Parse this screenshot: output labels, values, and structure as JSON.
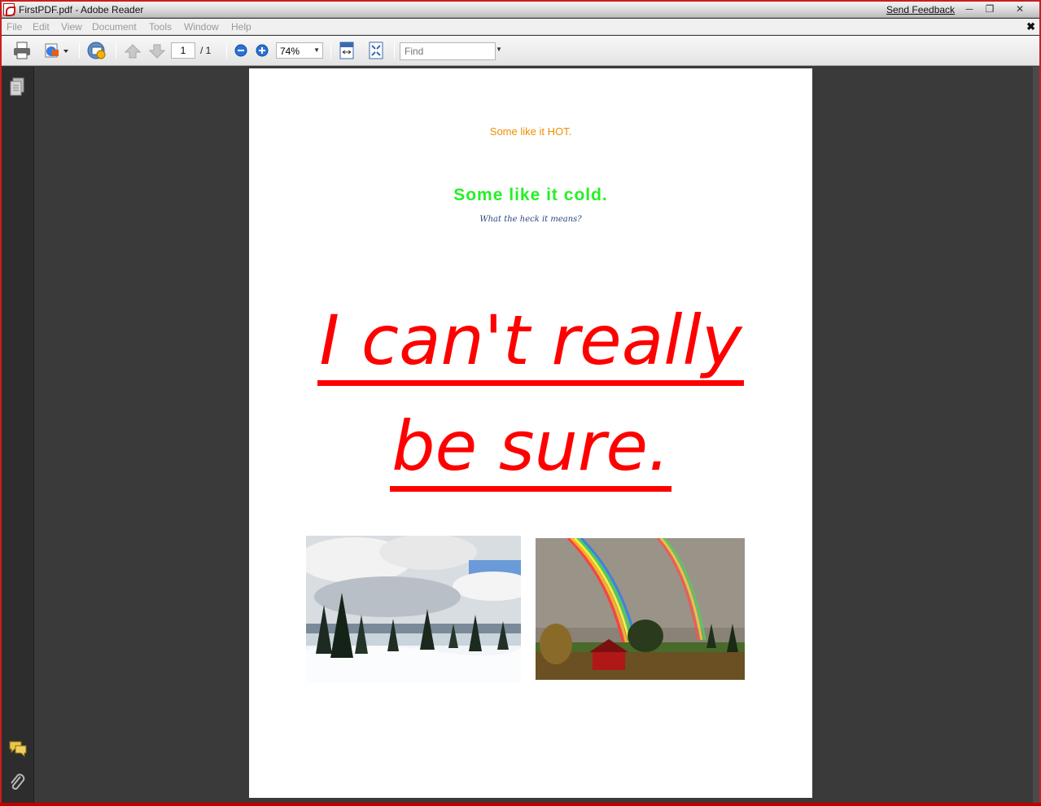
{
  "window": {
    "title": "FirstPDF.pdf - Adobe Reader",
    "send_feedback": "Send Feedback",
    "minimize": "─",
    "restore": "❐",
    "close": "✕"
  },
  "menu": {
    "items": [
      "File",
      "Edit",
      "View",
      "Document",
      "Tools",
      "Window",
      "Help"
    ],
    "close_doc": "✖"
  },
  "toolbar": {
    "page_current": "1",
    "page_total": "/ 1",
    "zoom": "74%",
    "find_placeholder": "Find"
  },
  "document": {
    "line1": "Some like it HOT.",
    "line2": "Some like it cold.",
    "line3": "What the heck it means?",
    "headline1": "I can't really",
    "headline2": "be sure."
  },
  "icons": {
    "print": "print-icon",
    "save_page": "save-page-icon",
    "email": "email-icon",
    "prev_page": "arrow-up-icon",
    "next_page": "arrow-down-icon",
    "zoom_out": "zoom-out-icon",
    "zoom_in": "zoom-in-icon",
    "fit_width": "fit-width-icon",
    "full_screen": "full-screen-icon",
    "pages_panel": "pages-icon",
    "comments": "comment-icon",
    "attachments": "paperclip-icon"
  },
  "colors": {
    "hot": "#f08c00",
    "cold": "#24f024",
    "headline": "#ff0000",
    "subtitle": "#2a4680"
  }
}
